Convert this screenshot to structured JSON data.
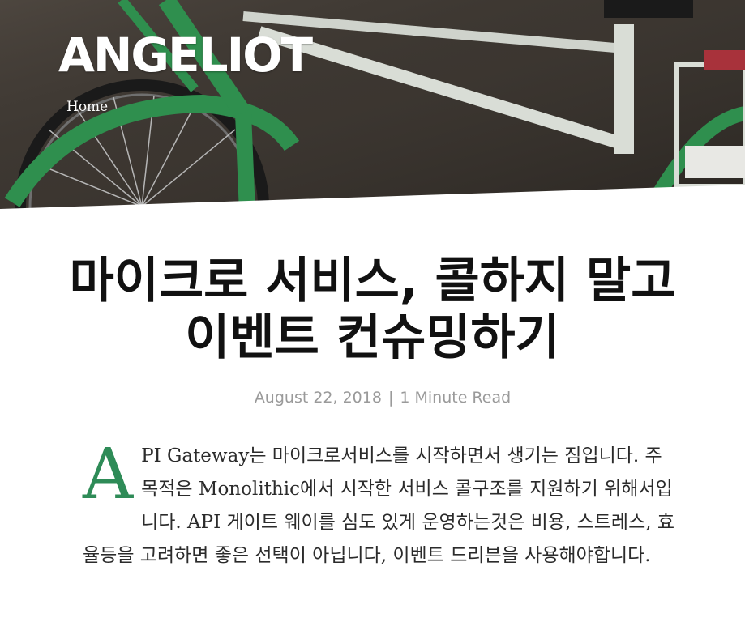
{
  "site": {
    "title": "ANGELIOT",
    "nav": {
      "home_label": "Home"
    }
  },
  "post": {
    "title": "마이크로 서비스, 콜하지 말고 이벤트 컨슈밍하기",
    "date": "August 22, 2018",
    "meta_separator": "|",
    "read_time": "1 Minute Read",
    "dropcap": "A",
    "body_text": "PI Gateway는 마이크로서비스를 시작하면서 생기는 짐입니다. 주 목적은 Monolithic에서 시작한 서비스 콜구조를 지원하기 위해서입니다. API 게이트 웨이를 심도 있게 운영하는것은 비용, 스트레스, 효율등을 고려하면 좋은 선택이 아닙니다, 이벤트 드리븐을 사용해야합니다."
  },
  "colors": {
    "accent": "#2e8b57",
    "title_text": "#111111",
    "meta_text": "#9a9a9a",
    "body_text": "#2b2b2b",
    "hero_bg": "#3b3631"
  },
  "images": {
    "hero": "bicycle-photo"
  }
}
